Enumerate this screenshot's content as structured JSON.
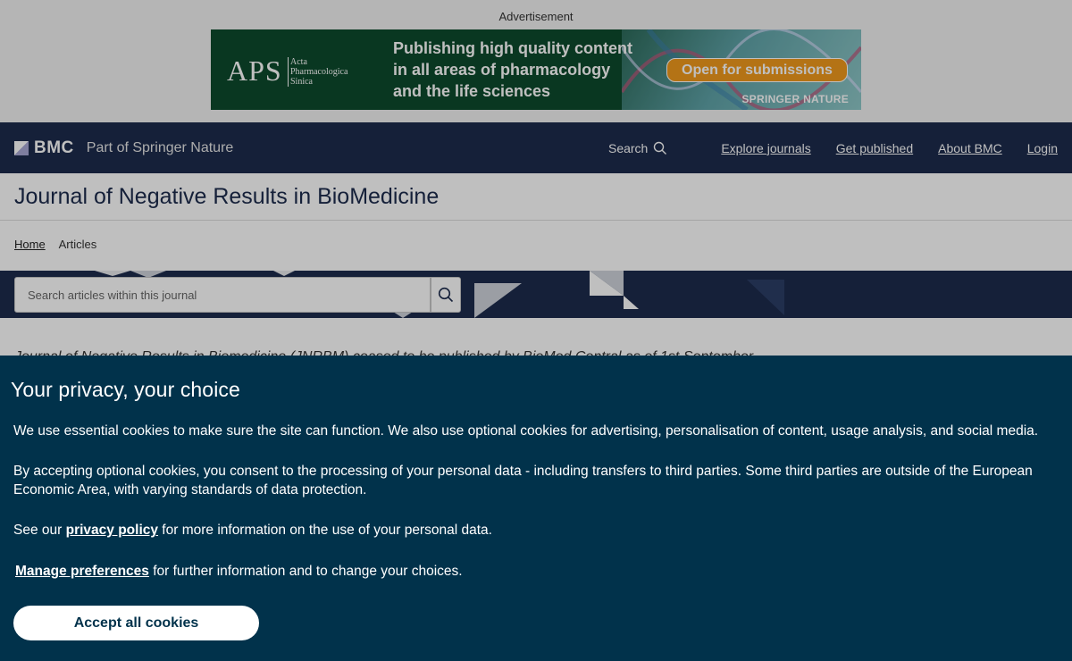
{
  "ad": {
    "label": "Advertisement",
    "logo": "APS",
    "logo_sub": [
      "Acta",
      "Pharmacologica",
      "Sinica"
    ],
    "headline": [
      "Publishing high quality content",
      "in all areas of pharmacology",
      "and the life sciences"
    ],
    "cta": "Open for submissions",
    "brand": "SPRINGER NATURE"
  },
  "nav": {
    "logo": "BMC",
    "tagline": "Part of Springer Nature",
    "search_label": "Search",
    "links": [
      "Explore journals",
      "Get published",
      "About BMC",
      "Login"
    ]
  },
  "journal": {
    "title": "Journal of Negative Results in BioMedicine"
  },
  "breadcrumb": {
    "home": "Home",
    "current": "Articles"
  },
  "search": {
    "placeholder": "Search articles within this journal"
  },
  "intro": {
    "text": "Journal of Negative Results in Biomedicine (JNRBM) ceased to be published by BioMed Central as of 1st September"
  },
  "cookie": {
    "title": "Your privacy, your choice",
    "p1": "We use essential cookies to make sure the site can function. We also use optional cookies for advertising, personalisation of content, usage analysis, and social media.",
    "p2": "By accepting optional cookies, you consent to the processing of your personal data - including transfers to third parties. Some third parties are outside of the European Economic Area, with varying standards of data protection.",
    "p3_before": "See our ",
    "p3_link": "privacy policy",
    "p3_after": " for more information on the use of your personal data.",
    "p4_link": "Manage preferences",
    "p4_after": " for further information and to change your choices.",
    "accept": "Accept all cookies"
  },
  "colors": {
    "nav_bg": "#1c2b4d",
    "cookie_bg": "#01324b",
    "ad_green": "#0d4a2c",
    "ad_orange": "#f19a1c"
  }
}
